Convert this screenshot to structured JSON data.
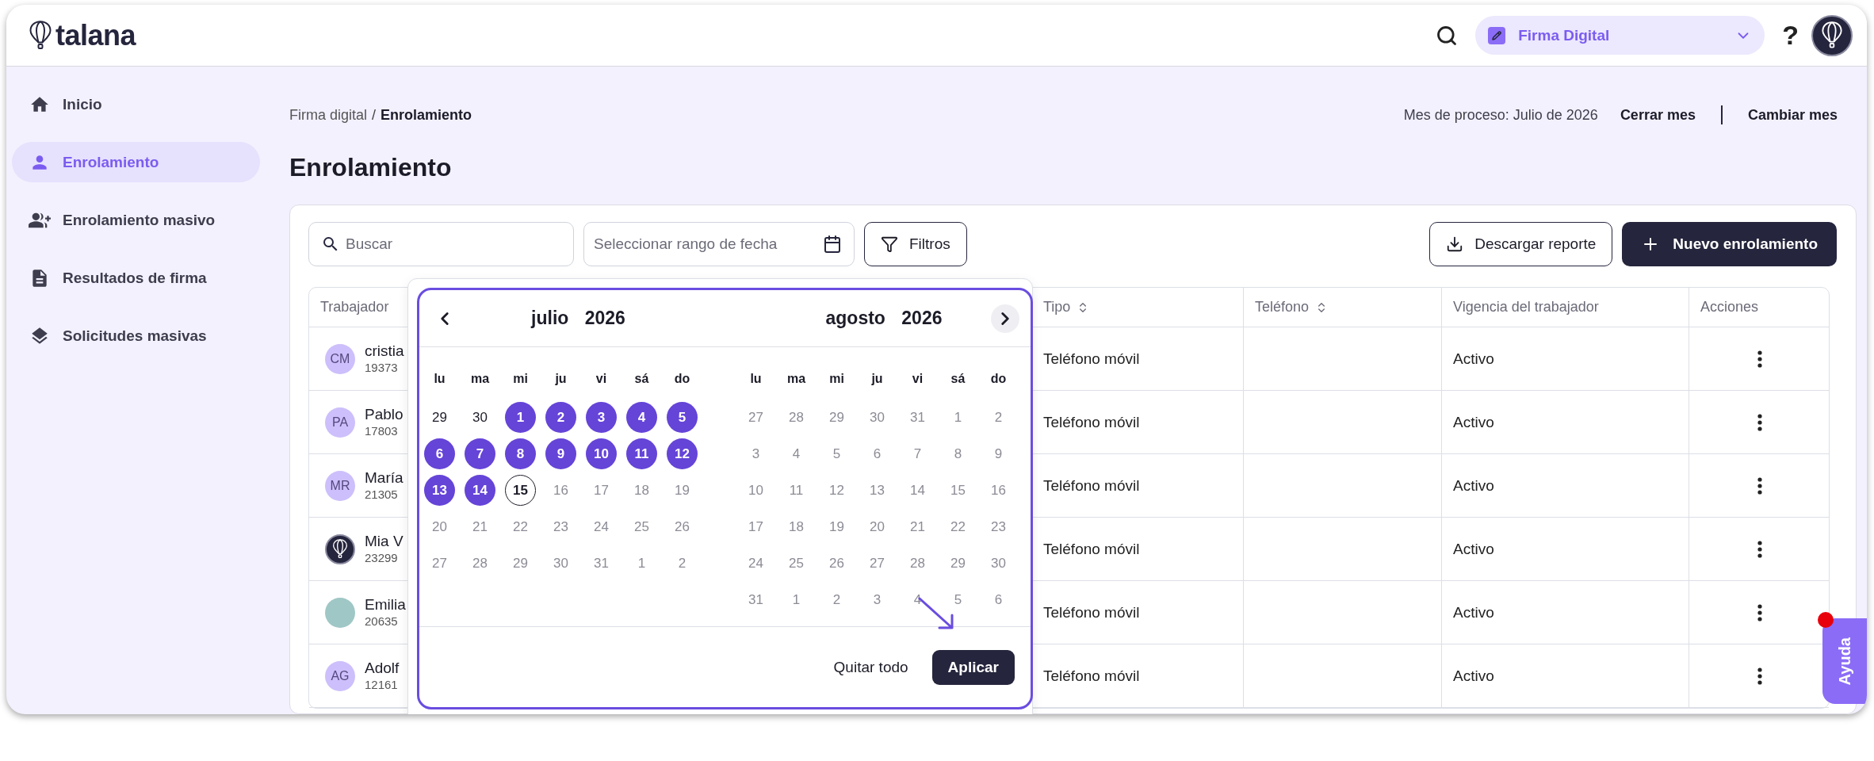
{
  "topbar": {
    "logo": "talana",
    "module": "Firma Digital",
    "help": "?"
  },
  "sidebar": {
    "items": [
      {
        "label": "Inicio",
        "selected": false
      },
      {
        "label": "Enrolamiento",
        "selected": true
      },
      {
        "label": "Enrolamiento masivo",
        "selected": false
      },
      {
        "label": "Resultados de firma",
        "selected": false
      },
      {
        "label": "Solicitudes masivas",
        "selected": false
      }
    ]
  },
  "breadcrumb": {
    "parent": "Firma digital",
    "separator": "/",
    "current": "Enrolamiento"
  },
  "process": {
    "month": "Mes de proceso: Julio de 2026",
    "actions": [
      "Cerrar mes",
      "Cambiar mes"
    ]
  },
  "title": "Enrolamiento",
  "toolbar": {
    "search": {
      "placeholder": "Buscar"
    },
    "date_range": {
      "placeholder": "Seleccionar rango de fecha"
    },
    "filters": "Filtros",
    "download": "Descargar reporte",
    "new": "Nuevo enrolamiento"
  },
  "table": {
    "columns": [
      {
        "label": "Trabajador",
        "sortable": false
      },
      {
        "label": "Tipo",
        "sortable": true
      },
      {
        "label": "Teléfono",
        "sortable": true
      },
      {
        "label": "Vigencia del trabajador",
        "sortable": false
      },
      {
        "label": "Acciones",
        "sortable": false
      }
    ],
    "rows": [
      {
        "avatar": {
          "kind": "initials",
          "initials": "CM"
        },
        "name": "cristia",
        "id": "19373",
        "tipo": "Teléfono móvil",
        "vigencia": "Activo"
      },
      {
        "avatar": {
          "kind": "initials",
          "initials": "PA"
        },
        "name": "Pablo",
        "id": "17803",
        "tipo": "Teléfono móvil",
        "vigencia": "Activo"
      },
      {
        "avatar": {
          "kind": "initials",
          "initials": "MR"
        },
        "name": "María",
        "id": "21305",
        "tipo": "Teléfono móvil",
        "vigencia": "Activo"
      },
      {
        "avatar": {
          "kind": "logo"
        },
        "name": "Mia V",
        "id": "23299",
        "tipo": "Teléfono móvil",
        "vigencia": "Activo"
      },
      {
        "avatar": {
          "kind": "photo"
        },
        "name": "Emilia",
        "id": "20635",
        "tipo": "Teléfono móvil",
        "vigencia": "Activo"
      },
      {
        "avatar": {
          "kind": "initials",
          "initials": "AG"
        },
        "name": "Adolf",
        "id": "12161",
        "tipo": "Teléfono móvil",
        "vigencia": "Activo"
      }
    ]
  },
  "date_picker": {
    "months": [
      {
        "month": "julio",
        "year": "2026",
        "weekdays": [
          "lu",
          "ma",
          "mi",
          "ju",
          "vi",
          "sá",
          "do"
        ],
        "days": [
          {
            "label": "29",
            "selected": false,
            "today": false,
            "disabled": false
          },
          {
            "label": "30",
            "selected": false,
            "today": false,
            "disabled": false
          },
          {
            "label": "1",
            "selected": true,
            "today": false,
            "disabled": false
          },
          {
            "label": "2",
            "selected": true,
            "today": false,
            "disabled": false
          },
          {
            "label": "3",
            "selected": true,
            "today": false,
            "disabled": false
          },
          {
            "label": "4",
            "selected": true,
            "today": false,
            "disabled": false
          },
          {
            "label": "5",
            "selected": true,
            "today": false,
            "disabled": false
          },
          {
            "label": "6",
            "selected": true,
            "today": false,
            "disabled": false
          },
          {
            "label": "7",
            "selected": true,
            "today": false,
            "disabled": false
          },
          {
            "label": "8",
            "selected": true,
            "today": false,
            "disabled": false
          },
          {
            "label": "9",
            "selected": true,
            "today": false,
            "disabled": false
          },
          {
            "label": "10",
            "selected": true,
            "today": false,
            "disabled": false
          },
          {
            "label": "11",
            "selected": true,
            "today": false,
            "disabled": false
          },
          {
            "label": "12",
            "selected": true,
            "today": false,
            "disabled": false
          },
          {
            "label": "13",
            "selected": true,
            "today": false,
            "disabled": false
          },
          {
            "label": "14",
            "selected": true,
            "today": false,
            "disabled": false
          },
          {
            "label": "15",
            "selected": false,
            "today": true,
            "disabled": false
          },
          {
            "label": "16",
            "selected": false,
            "today": false,
            "disabled": true
          },
          {
            "label": "17",
            "selected": false,
            "today": false,
            "disabled": true
          },
          {
            "label": "18",
            "selected": false,
            "today": false,
            "disabled": true
          },
          {
            "label": "19",
            "selected": false,
            "today": false,
            "disabled": true
          },
          {
            "label": "20",
            "selected": false,
            "today": false,
            "disabled": true
          },
          {
            "label": "21",
            "selected": false,
            "today": false,
            "disabled": true
          },
          {
            "label": "22",
            "selected": false,
            "today": false,
            "disabled": true
          },
          {
            "label": "23",
            "selected": false,
            "today": false,
            "disabled": true
          },
          {
            "label": "24",
            "selected": false,
            "today": false,
            "disabled": true
          },
          {
            "label": "25",
            "selected": false,
            "today": false,
            "disabled": true
          },
          {
            "label": "26",
            "selected": false,
            "today": false,
            "disabled": true
          },
          {
            "label": "27",
            "selected": false,
            "today": false,
            "disabled": true
          },
          {
            "label": "28",
            "selected": false,
            "today": false,
            "disabled": true
          },
          {
            "label": "29",
            "selected": false,
            "today": false,
            "disabled": true
          },
          {
            "label": "30",
            "selected": false,
            "today": false,
            "disabled": true
          },
          {
            "label": "31",
            "selected": false,
            "today": false,
            "disabled": true
          },
          {
            "label": "1",
            "selected": false,
            "today": false,
            "disabled": true
          },
          {
            "label": "2",
            "selected": false,
            "today": false,
            "disabled": true
          }
        ]
      },
      {
        "month": "agosto",
        "year": "2026",
        "weekdays": [
          "lu",
          "ma",
          "mi",
          "ju",
          "vi",
          "sá",
          "do"
        ],
        "days": [
          {
            "label": "27",
            "selected": false,
            "today": false,
            "disabled": true
          },
          {
            "label": "28",
            "selected": false,
            "today": false,
            "disabled": true
          },
          {
            "label": "29",
            "selected": false,
            "today": false,
            "disabled": true
          },
          {
            "label": "30",
            "selected": false,
            "today": false,
            "disabled": true
          },
          {
            "label": "31",
            "selected": false,
            "today": false,
            "disabled": true
          },
          {
            "label": "1",
            "selected": false,
            "today": false,
            "disabled": true
          },
          {
            "label": "2",
            "selected": false,
            "today": false,
            "disabled": true
          },
          {
            "label": "3",
            "selected": false,
            "today": false,
            "disabled": true
          },
          {
            "label": "4",
            "selected": false,
            "today": false,
            "disabled": true
          },
          {
            "label": "5",
            "selected": false,
            "today": false,
            "disabled": true
          },
          {
            "label": "6",
            "selected": false,
            "today": false,
            "disabled": true
          },
          {
            "label": "7",
            "selected": false,
            "today": false,
            "disabled": true
          },
          {
            "label": "8",
            "selected": false,
            "today": false,
            "disabled": true
          },
          {
            "label": "9",
            "selected": false,
            "today": false,
            "disabled": true
          },
          {
            "label": "10",
            "selected": false,
            "today": false,
            "disabled": true
          },
          {
            "label": "11",
            "selected": false,
            "today": false,
            "disabled": true
          },
          {
            "label": "12",
            "selected": false,
            "today": false,
            "disabled": true
          },
          {
            "label": "13",
            "selected": false,
            "today": false,
            "disabled": true
          },
          {
            "label": "14",
            "selected": false,
            "today": false,
            "disabled": true
          },
          {
            "label": "15",
            "selected": false,
            "today": false,
            "disabled": true
          },
          {
            "label": "16",
            "selected": false,
            "today": false,
            "disabled": true
          },
          {
            "label": "17",
            "selected": false,
            "today": false,
            "disabled": true
          },
          {
            "label": "18",
            "selected": false,
            "today": false,
            "disabled": true
          },
          {
            "label": "19",
            "selected": false,
            "today": false,
            "disabled": true
          },
          {
            "label": "20",
            "selected": false,
            "today": false,
            "disabled": true
          },
          {
            "label": "21",
            "selected": false,
            "today": false,
            "disabled": true
          },
          {
            "label": "22",
            "selected": false,
            "today": false,
            "disabled": true
          },
          {
            "label": "23",
            "selected": false,
            "today": false,
            "disabled": true
          },
          {
            "label": "24",
            "selected": false,
            "today": false,
            "disabled": true
          },
          {
            "label": "25",
            "selected": false,
            "today": false,
            "disabled": true
          },
          {
            "label": "26",
            "selected": false,
            "today": false,
            "disabled": true
          },
          {
            "label": "27",
            "selected": false,
            "today": false,
            "disabled": true
          },
          {
            "label": "28",
            "selected": false,
            "today": false,
            "disabled": true
          },
          {
            "label": "29",
            "selected": false,
            "today": false,
            "disabled": true
          },
          {
            "label": "30",
            "selected": false,
            "today": false,
            "disabled": true
          },
          {
            "label": "31",
            "selected": false,
            "today": false,
            "disabled": true
          },
          {
            "label": "1",
            "selected": false,
            "today": false,
            "disabled": true
          },
          {
            "label": "2",
            "selected": false,
            "today": false,
            "disabled": true
          },
          {
            "label": "3",
            "selected": false,
            "today": false,
            "disabled": true
          },
          {
            "label": "4",
            "selected": false,
            "today": false,
            "disabled": true
          },
          {
            "label": "5",
            "selected": false,
            "today": false,
            "disabled": true
          },
          {
            "label": "6",
            "selected": false,
            "today": false,
            "disabled": true
          }
        ]
      }
    ],
    "clear": "Quitar todo",
    "apply": "Aplicar"
  },
  "help_tab": {
    "label": "Ayuda",
    "notification": true
  }
}
